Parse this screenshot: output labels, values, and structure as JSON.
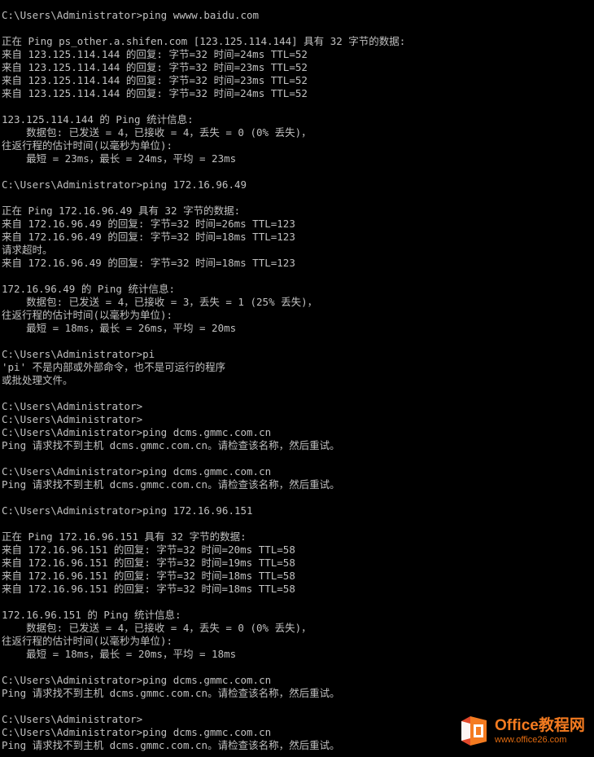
{
  "console": {
    "lines": [
      "C:\\Users\\Administrator>ping wwww.baidu.com",
      "",
      "正在 Ping ps_other.a.shifen.com [123.125.114.144] 具有 32 字节的数据:",
      "来自 123.125.114.144 的回复: 字节=32 时间=24ms TTL=52",
      "来自 123.125.114.144 的回复: 字节=32 时间=23ms TTL=52",
      "来自 123.125.114.144 的回复: 字节=32 时间=23ms TTL=52",
      "来自 123.125.114.144 的回复: 字节=32 时间=24ms TTL=52",
      "",
      "123.125.114.144 的 Ping 统计信息:",
      "    数据包: 已发送 = 4，已接收 = 4，丢失 = 0 (0% 丢失)，",
      "往返行程的估计时间(以毫秒为单位):",
      "    最短 = 23ms，最长 = 24ms，平均 = 23ms",
      "",
      "C:\\Users\\Administrator>ping 172.16.96.49",
      "",
      "正在 Ping 172.16.96.49 具有 32 字节的数据:",
      "来自 172.16.96.49 的回复: 字节=32 时间=26ms TTL=123",
      "来自 172.16.96.49 的回复: 字节=32 时间=18ms TTL=123",
      "请求超时。",
      "来自 172.16.96.49 的回复: 字节=32 时间=18ms TTL=123",
      "",
      "172.16.96.49 的 Ping 统计信息:",
      "    数据包: 已发送 = 4，已接收 = 3，丢失 = 1 (25% 丢失)，",
      "往返行程的估计时间(以毫秒为单位):",
      "    最短 = 18ms，最长 = 26ms，平均 = 20ms",
      "",
      "C:\\Users\\Administrator>pi",
      "'pi' 不是内部或外部命令，也不是可运行的程序",
      "或批处理文件。",
      "",
      "C:\\Users\\Administrator>",
      "C:\\Users\\Administrator>",
      "C:\\Users\\Administrator>ping dcms.gmmc.com.cn",
      "Ping 请求找不到主机 dcms.gmmc.com.cn。请检查该名称，然后重试。",
      "",
      "C:\\Users\\Administrator>ping dcms.gmmc.com.cn",
      "Ping 请求找不到主机 dcms.gmmc.com.cn。请检查该名称，然后重试。",
      "",
      "C:\\Users\\Administrator>ping 172.16.96.151",
      "",
      "正在 Ping 172.16.96.151 具有 32 字节的数据:",
      "来自 172.16.96.151 的回复: 字节=32 时间=20ms TTL=58",
      "来自 172.16.96.151 的回复: 字节=32 时间=19ms TTL=58",
      "来自 172.16.96.151 的回复: 字节=32 时间=18ms TTL=58",
      "来自 172.16.96.151 的回复: 字节=32 时间=18ms TTL=58",
      "",
      "172.16.96.151 的 Ping 统计信息:",
      "    数据包: 已发送 = 4，已接收 = 4，丢失 = 0 (0% 丢失)，",
      "往返行程的估计时间(以毫秒为单位):",
      "    最短 = 18ms，最长 = 20ms，平均 = 18ms",
      "",
      "C:\\Users\\Administrator>ping dcms.gmmc.com.cn",
      "Ping 请求找不到主机 dcms.gmmc.com.cn。请检查该名称，然后重试。",
      "",
      "C:\\Users\\Administrator>",
      "C:\\Users\\Administrator>ping dcms.gmmc.com.cn",
      "Ping 请求找不到主机 dcms.gmmc.com.cn。请检查该名称，然后重试。"
    ]
  },
  "watermark": {
    "title": "Office教程网",
    "url": "www.office26.com",
    "icon": "office-logo-icon"
  },
  "colors": {
    "background": "#000000",
    "text": "#c0c0c0",
    "brand_orange": "#f47b20",
    "brand_red": "#e2482a"
  }
}
